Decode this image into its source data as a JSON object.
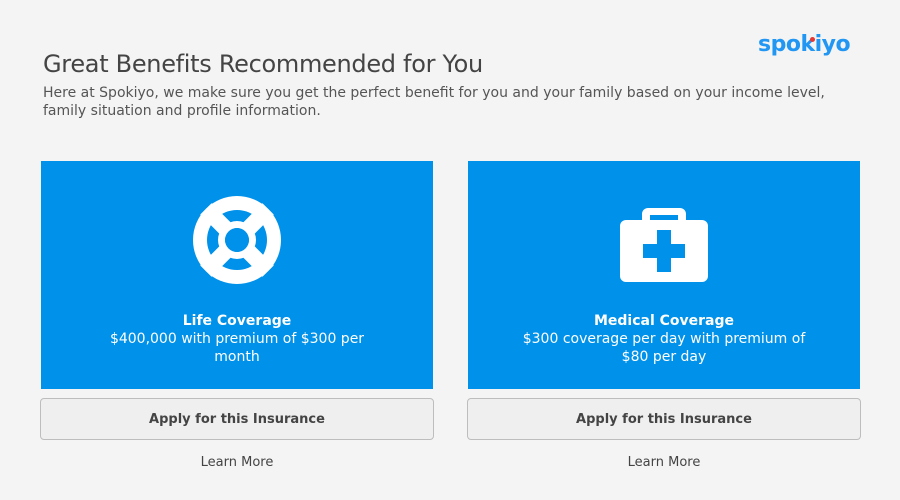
{
  "brand": {
    "logo_text": "spokiyo",
    "logo_color": "#2196f3",
    "logo_accent_color": "#e53935"
  },
  "header": {
    "title": "Great Benefits Recommended for You",
    "subtitle": "Here at Spokiyo, we make sure you get the perfect benefit for you and your family based on your income level, family situation and profile information."
  },
  "colors": {
    "card_background": "#0091ea",
    "page_background": "#f4f4f4",
    "button_background": "#efefef"
  },
  "benefits": [
    {
      "icon": "lifebuoy-icon",
      "title": "Life Coverage",
      "description": "$400,000 with premium of $300 per month",
      "apply_label": "Apply for this Insurance",
      "learn_more_label": "Learn More"
    },
    {
      "icon": "first-aid-kit-icon",
      "title": "Medical Coverage",
      "description": "$300 coverage per day with premium of $80 per day",
      "apply_label": "Apply for this Insurance",
      "learn_more_label": "Learn More"
    }
  ]
}
